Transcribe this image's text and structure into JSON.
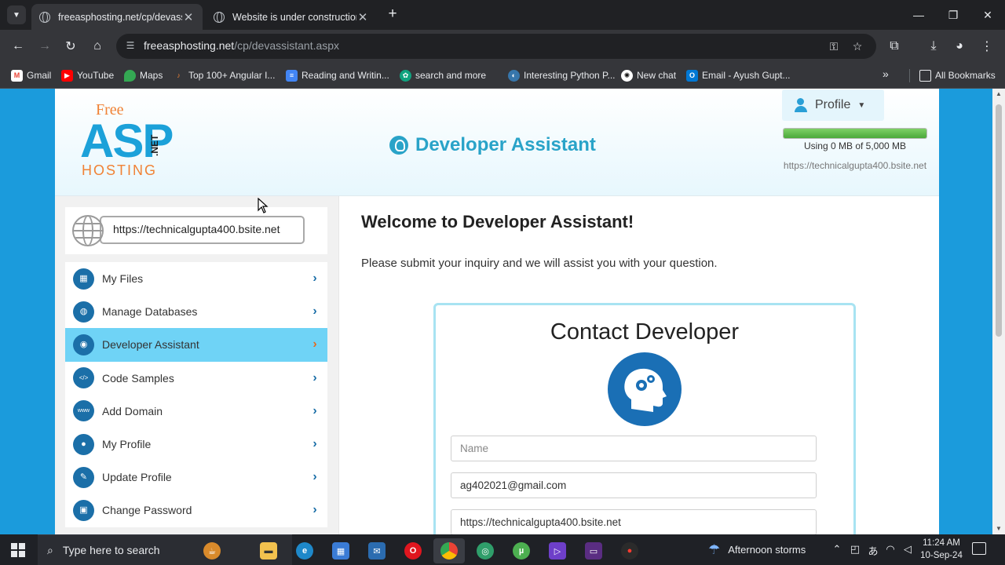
{
  "browser": {
    "tabs": [
      {
        "title": "freeasphosting.net/cp/devassistant.aspx",
        "active": true
      },
      {
        "title": "Website is under construction",
        "active": false
      }
    ],
    "url_domain": "freeasphosting.net",
    "url_path": "/cp/devassistant.aspx",
    "bookmarks": [
      {
        "label": "Gmail",
        "icon": "gmail-icon",
        "color": "#ea4335"
      },
      {
        "label": "YouTube",
        "icon": "youtube-icon",
        "color": "#ff0000"
      },
      {
        "label": "Maps",
        "icon": "maps-icon",
        "color": "#34a853"
      },
      {
        "label": "Top 100+ Angular I...",
        "icon": "angular-icon",
        "color": "#f08235"
      },
      {
        "label": "Reading and Writin...",
        "icon": "docs-icon",
        "color": "#4285f4"
      },
      {
        "label": "search and more",
        "icon": "chatgpt-icon",
        "color": "#10a37f"
      },
      {
        "label": "Interesting Python P...",
        "icon": "python-icon",
        "color": "#3776ab"
      },
      {
        "label": "New chat",
        "icon": "openai-icon",
        "color": "#ffffff"
      },
      {
        "label": "Email - Ayush Gupt...",
        "icon": "outlook-icon",
        "color": "#0078d4"
      }
    ],
    "all_bookmarks": "All Bookmarks"
  },
  "site": {
    "logo": {
      "free": "Free",
      "asp": "ASP",
      "hosting": "HOSTING",
      "net": ".NET"
    },
    "page_title": "Developer Assistant",
    "profile_label": "Profile",
    "usage_text": "Using 0 MB of 5,000 MB",
    "usage_fraction": 1.0,
    "site_url": "https://technicalgupta400.bsite.net",
    "domain": "https://technicalgupta400.bsite.net",
    "accent": "#29a3c8"
  },
  "sidebar": {
    "items": [
      {
        "label": "My Files",
        "icon": "files-icon",
        "glyph": "▦",
        "active": false
      },
      {
        "label": "Manage Databases",
        "icon": "database-icon",
        "glyph": "◍",
        "active": false
      },
      {
        "label": "Developer Assistant",
        "icon": "head-gear-icon",
        "glyph": "◉",
        "active": true
      },
      {
        "label": "Code Samples",
        "icon": "code-icon",
        "glyph": "</>",
        "active": false
      },
      {
        "label": "Add Domain",
        "icon": "www-icon",
        "glyph": "www",
        "active": false
      },
      {
        "label": "My Profile",
        "icon": "user-icon",
        "glyph": "●",
        "active": false
      },
      {
        "label": "Update Profile",
        "icon": "user-edit-icon",
        "glyph": "✎",
        "active": false
      },
      {
        "label": "Change Password",
        "icon": "lock-icon",
        "glyph": "▣",
        "active": false
      }
    ]
  },
  "main": {
    "welcome": "Welcome to Developer Assistant!",
    "intro": "Please submit your inquiry and we will assist you with your question.",
    "card_title": "Contact Developer",
    "fields": {
      "name_placeholder": "Name",
      "email_value": "ag402021@gmail.com",
      "website_value": "https://technicalgupta400.bsite.net"
    }
  },
  "taskbar": {
    "search_placeholder": "Type here to search",
    "weather": "Afternoon storms",
    "time": "11:24 AM",
    "date": "10-Sep-24"
  }
}
